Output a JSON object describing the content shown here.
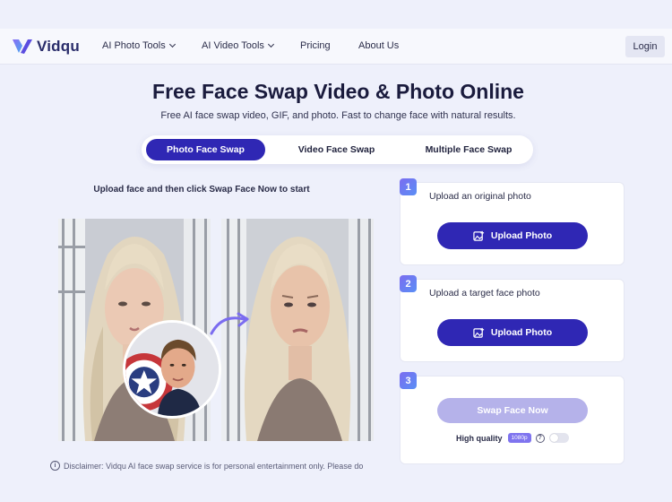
{
  "brand": {
    "name": "Vidqu",
    "icon": "vidqu-logo-icon",
    "colors": {
      "primary": "#2f27b4",
      "accent": "#7b6cf0"
    }
  },
  "nav": {
    "items": [
      {
        "label": "AI Photo Tools",
        "dropdown": true
      },
      {
        "label": "AI Video Tools",
        "dropdown": true
      },
      {
        "label": "Pricing"
      },
      {
        "label": "About Us"
      }
    ],
    "login": "Login"
  },
  "hero": {
    "title": "Free Face Swap Video & Photo Online",
    "subtitle": "Free AI face swap video, GIF, and photo. Fast to change face with natural results."
  },
  "tabs": [
    {
      "label": "Photo Face Swap",
      "active": true
    },
    {
      "label": "Video Face Swap",
      "active": false
    },
    {
      "label": "Multiple Face Swap",
      "active": false
    }
  ],
  "preview": {
    "instruction": "Upload face and then click Swap Face Now to start"
  },
  "steps": [
    {
      "num": "1",
      "label": "Upload an original photo",
      "button": "Upload Photo"
    },
    {
      "num": "2",
      "label": "Upload a target face photo",
      "button": "Upload Photo"
    },
    {
      "num": "3",
      "button": "Swap Face Now",
      "quality_label": "High quality",
      "quality_badge": "1080p",
      "help": "?",
      "toggle_on": false
    }
  ],
  "disclaimer": {
    "icon": "i",
    "text": "Disclaimer: Vidqu AI face swap service is for personal entertainment only. Please do"
  }
}
